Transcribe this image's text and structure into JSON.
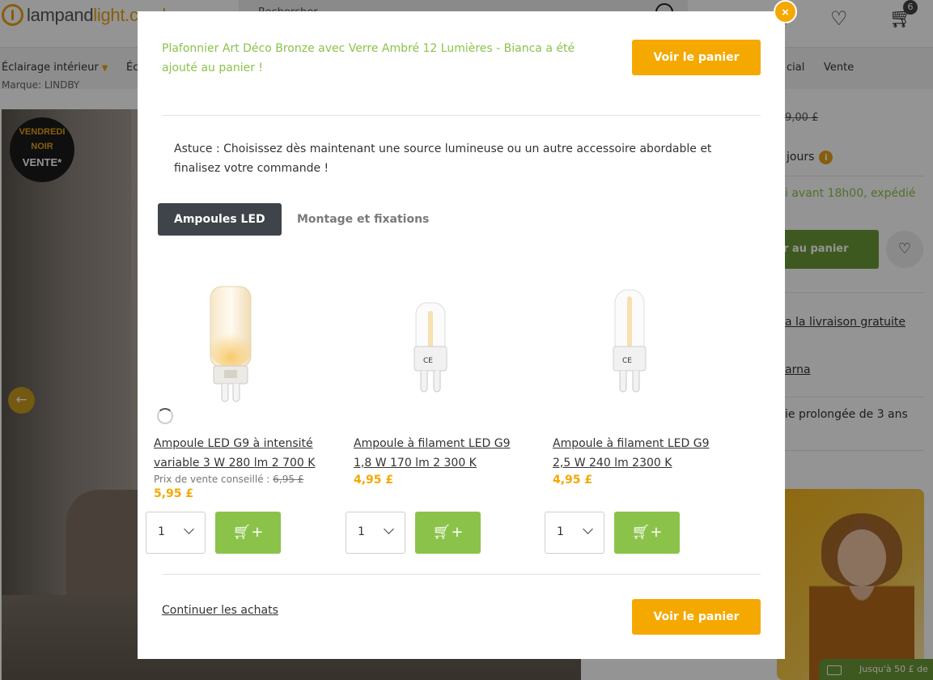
{
  "header": {
    "logo_main": "lampand",
    "logo_accent": "light.co.uk",
    "search_text": "Rechercher",
    "cart_count": "6"
  },
  "nav": {
    "items": [
      "Éclairage intérieur",
      "Éc",
      "cial",
      "Vente"
    ]
  },
  "page": {
    "brand_line": "Marque: LINDBY",
    "badge": {
      "line1": "VENDREDI",
      "line2": "NOIR",
      "line3": "VENTE*"
    },
    "old_price": "9,00 £",
    "delivery_days": "jours",
    "order_text": "i avant 18h00, expédié",
    "add_to_cart": "r au panier",
    "free_delivery_link": "a la livraison gratuite",
    "klarna_link": "arna",
    "warranty_text": "ie prolongée de 3 ans",
    "newsletter_text": "Jusqu'à 50 £ de"
  },
  "modal": {
    "close_label": "×",
    "added_message": "Plafonnier Art Déco Bronze avec Verre Ambré 12 Lumières - Bianca a été ajouté au panier !",
    "view_cart_label": "Voir le panier",
    "tip": "Astuce : Choisissez dès maintenant une source lumineuse ou un autre accessoire abordable et finalisez votre commande !",
    "tabs": [
      {
        "label": "Ampoules LED",
        "active": true
      },
      {
        "label": "Montage et fixations",
        "active": false
      }
    ],
    "msrp_label": "Prix de vente conseillé :",
    "products": [
      {
        "title": "Ampoule LED G9 à intensité variable 3 W 280 lm 2 700 K",
        "msrp": "6,95 £",
        "price": "5,95 £",
        "qty": "1",
        "bulb": "frosted"
      },
      {
        "title": "Ampoule à filament LED G9 1,8 W 170 lm 2 300 K",
        "msrp": "",
        "price": "4,95 £",
        "qty": "1",
        "bulb": "filament"
      },
      {
        "title": "Ampoule à filament LED G9 2,5 W 240 lm 2300 K",
        "msrp": "",
        "price": "4,95 £",
        "qty": "1",
        "bulb": "filament"
      }
    ],
    "add_icon": "cart-plus-icon",
    "continue_label": "Continuer les achats"
  },
  "colors": {
    "accent_yellow": "#f5a800",
    "success_green": "#8bc34a",
    "tab_dark": "#3e4449"
  }
}
